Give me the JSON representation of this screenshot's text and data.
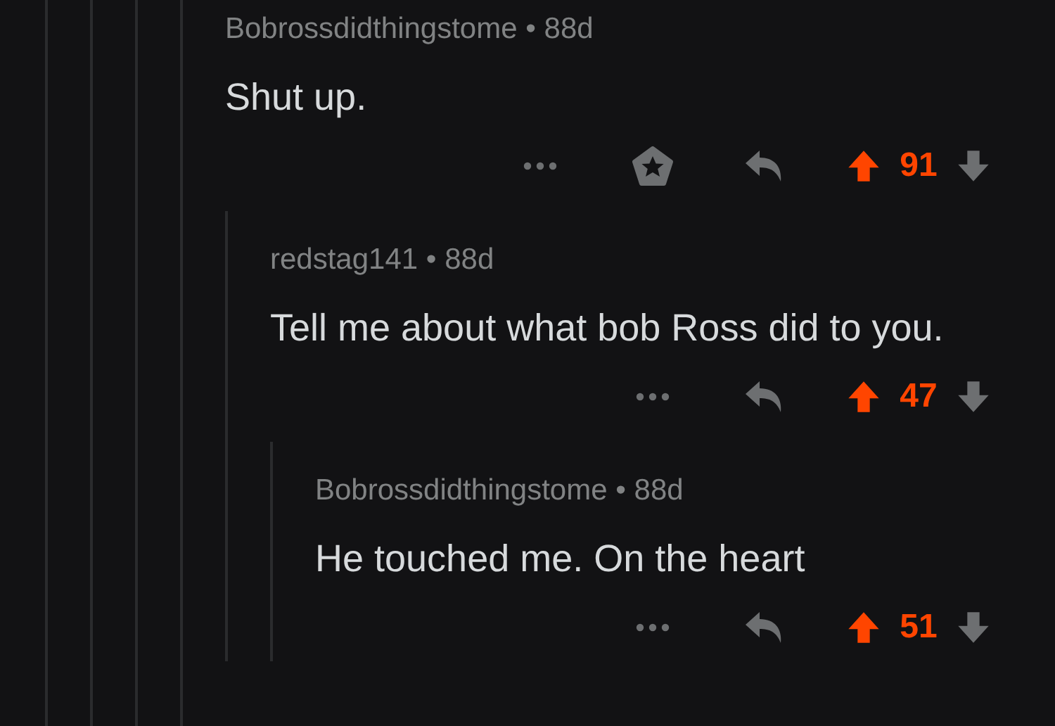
{
  "comments": [
    {
      "meta": "Bobrossdidthingstome • 88d",
      "body": "Shut up.",
      "award": true,
      "upvoted": true,
      "downvoted": false,
      "score": "91",
      "children": [
        {
          "meta": "redstag141 • 88d",
          "body": "Tell me about what bob Ross did to you.",
          "award": false,
          "upvoted": true,
          "downvoted": false,
          "score": "47",
          "children": [
            {
              "meta": "Bobrossdidthingstome • 88d",
              "body": "He touched me. On the heart",
              "award": false,
              "upvoted": true,
              "downvoted": false,
              "score": "51"
            }
          ]
        }
      ]
    }
  ]
}
